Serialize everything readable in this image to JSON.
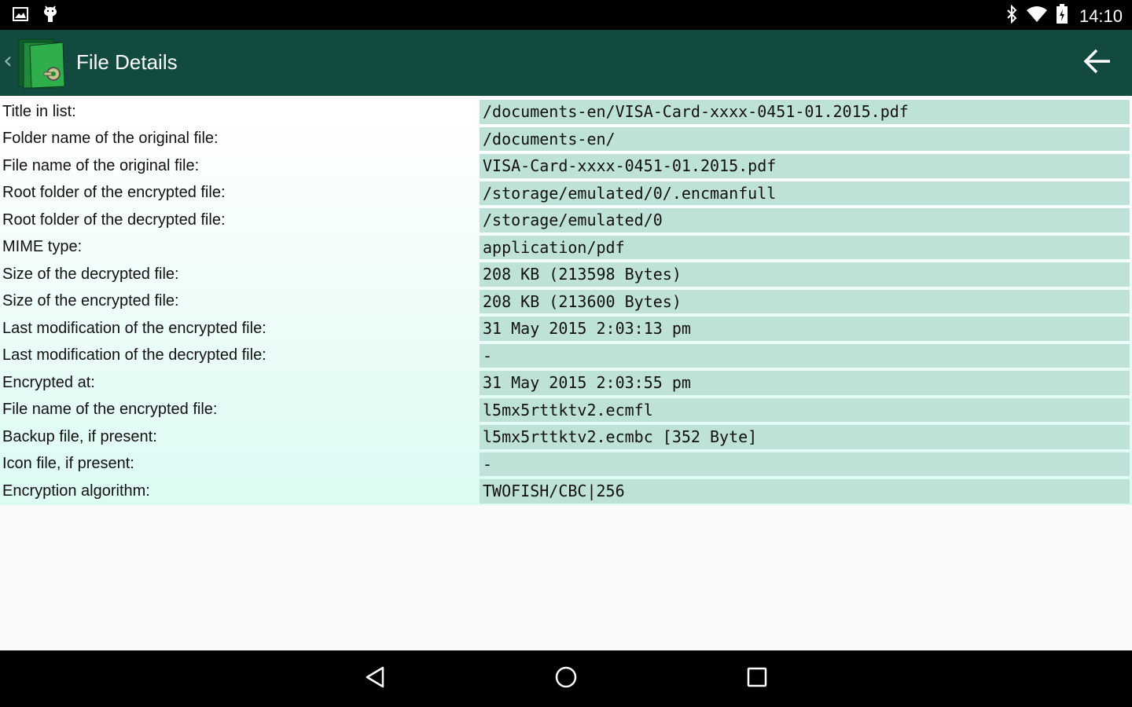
{
  "status_bar": {
    "time": "14:10",
    "icons": [
      "gallery-icon",
      "android-debug-icon",
      "bluetooth-icon",
      "wifi-icon",
      "battery-icon"
    ]
  },
  "app_bar": {
    "title": "File Details",
    "icon": "encrypted-folder-icon",
    "back_icon": "arrow-left-icon"
  },
  "details": [
    {
      "label": "Title in list:",
      "value": "/documents-en/VISA-Card-xxxx-0451-01.2015.pdf"
    },
    {
      "label": "Folder name of the original file:",
      "value": "/documents-en/"
    },
    {
      "label": "File name of the original file:",
      "value": "VISA-Card-xxxx-0451-01.2015.pdf"
    },
    {
      "label": "Root folder of the encrypted file:",
      "value": "/storage/emulated/0/.encmanfull"
    },
    {
      "label": "Root folder of the decrypted file:",
      "value": "/storage/emulated/0"
    },
    {
      "label": "MIME type:",
      "value": "application/pdf"
    },
    {
      "label": "Size of the decrypted file:",
      "value": "208 KB (213598 Bytes)"
    },
    {
      "label": "Size of the encrypted file:",
      "value": "208 KB (213600 Bytes)"
    },
    {
      "label": "Last modification of the encrypted file:",
      "value": "31 May 2015 2:03:13 pm"
    },
    {
      "label": "Last modification of the decrypted file:",
      "value": "-"
    },
    {
      "label": "Encrypted at:",
      "value": "31 May 2015 2:03:55 pm"
    },
    {
      "label": "File name of the encrypted file:",
      "value": "l5mx5rttktv2.ecmfl"
    },
    {
      "label": "Backup file, if present:",
      "value": "l5mx5rttktv2.ecmbc [352 Byte]"
    },
    {
      "label": "Icon file, if present:",
      "value": "-"
    },
    {
      "label": "Encryption algorithm:",
      "value": "TWOFISH/CBC|256"
    }
  ],
  "nav_bar": {
    "icons": [
      "nav-back-icon",
      "nav-home-icon",
      "nav-recents-icon"
    ]
  },
  "colors": {
    "status_bar": "#000000",
    "app_bar": "#124a40",
    "label_bg_top": "#ffffff",
    "label_bg_bottom": "#ddfaf3",
    "value_bg": "#bfe2d8",
    "nav_bar": "#000000"
  }
}
